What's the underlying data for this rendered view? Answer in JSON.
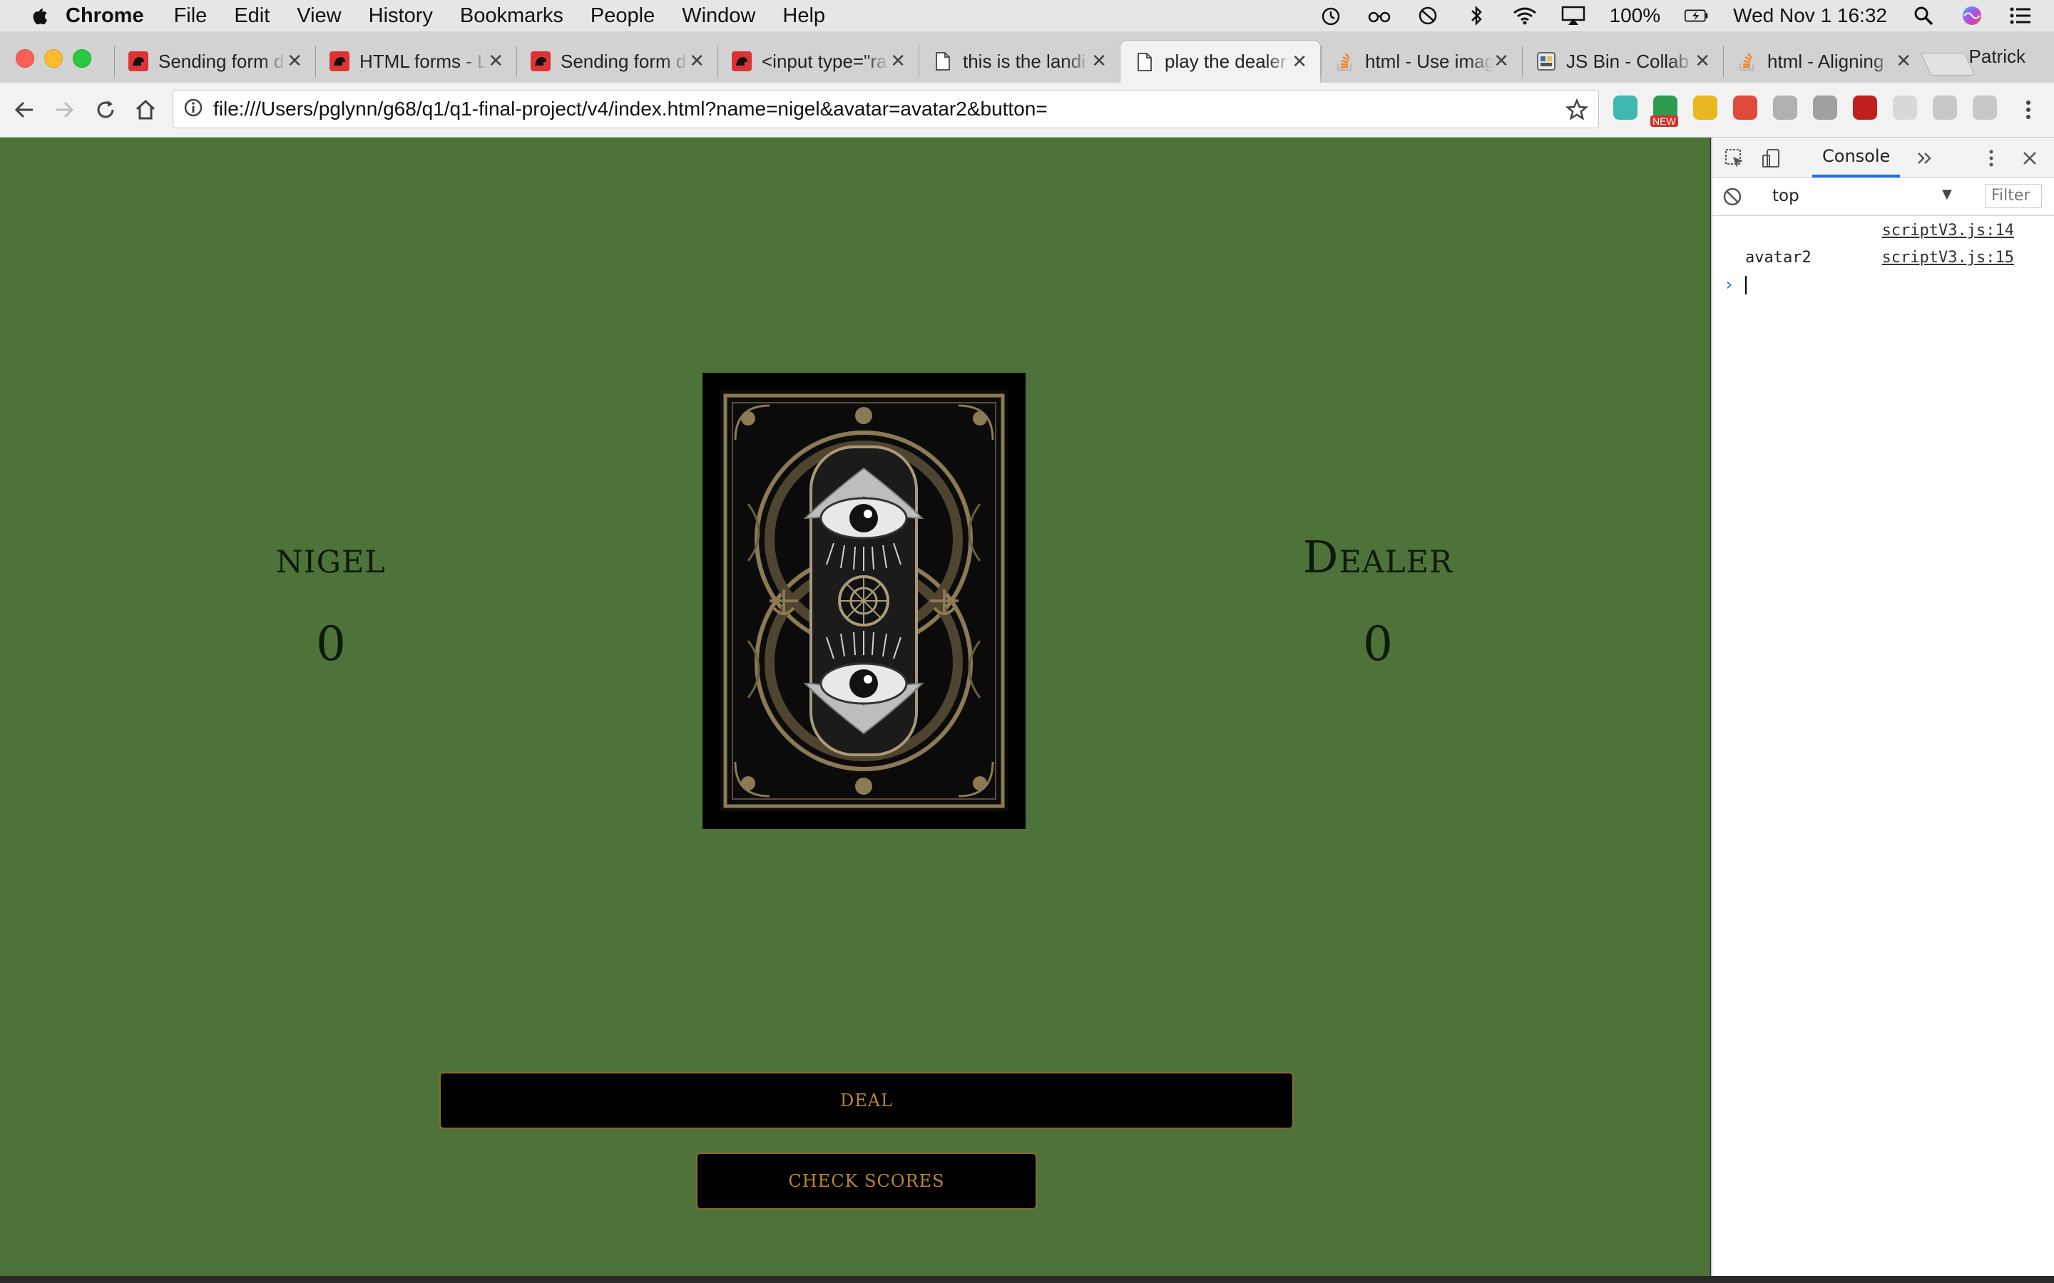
{
  "menubar": {
    "app": "Chrome",
    "items": [
      "File",
      "Edit",
      "View",
      "History",
      "Bookmarks",
      "People",
      "Window",
      "Help"
    ],
    "battery": "100%",
    "datetime": "Wed Nov 1  16:32"
  },
  "browser": {
    "profile": "Patrick",
    "tabs": [
      {
        "title": "Sending form d",
        "favicon": "mdn-icon"
      },
      {
        "title": "HTML forms - L",
        "favicon": "mdn-icon"
      },
      {
        "title": "Sending form d",
        "favicon": "mdn-icon"
      },
      {
        "title": "<input type=\"ra",
        "favicon": "mdn-icon"
      },
      {
        "title": "this is the landi",
        "favicon": "file-icon"
      },
      {
        "title": "play the dealer",
        "favicon": "file-icon",
        "active": true
      },
      {
        "title": "html - Use imag",
        "favicon": "stackoverflow-icon"
      },
      {
        "title": "JS Bin - Collab",
        "favicon": "jsbin-icon"
      },
      {
        "title": "html - Aligning",
        "favicon": "stackoverflow-icon"
      }
    ],
    "url": "file:///Users/pglynn/g68/q1/q1-final-project/v4/index.html?name=nigel&avatar=avatar2&button=",
    "extensions": [
      {
        "name": "m-extension-icon",
        "color": "#3fb8b0",
        "label": ""
      },
      {
        "name": "grammarly-new-icon",
        "color": "#2f9a52",
        "label": "NEW"
      },
      {
        "name": "yellow-extension-icon",
        "color": "#e8b820",
        "label": ""
      },
      {
        "name": "red-circle-extension-icon",
        "color": "#e04a3a",
        "label": ""
      },
      {
        "name": "grey-circle-extension-icon",
        "color": "#b0b0b0",
        "label": ""
      },
      {
        "name": "grey-square-extension-icon",
        "color": "#a0a0a0",
        "label": ""
      },
      {
        "name": "red-play-extension-icon",
        "color": "#c0211f",
        "label": ""
      },
      {
        "name": "blank-extension-icon",
        "color": "#d8d8d8",
        "label": ""
      },
      {
        "name": "json-extension-icon",
        "color": "#c8c8c8",
        "label": ""
      },
      {
        "name": "css-extension-icon",
        "color": "#c8c8c8",
        "label": ""
      }
    ]
  },
  "game": {
    "player_name": "nigel",
    "player_score": "0",
    "dealer_name": "Dealer",
    "dealer_score": "0",
    "deal_label": "DEAL",
    "check_label": "CHECK SCORES",
    "bg_color": "#4d733a",
    "button_text_color": "#b8862e"
  },
  "devtools": {
    "active_tab": "Console",
    "context": "top",
    "filter_placeholder": "Filter",
    "logs": [
      {
        "message": "",
        "source": "scriptV3.js:14"
      },
      {
        "message": "avatar2",
        "source": "scriptV3.js:15"
      }
    ]
  }
}
